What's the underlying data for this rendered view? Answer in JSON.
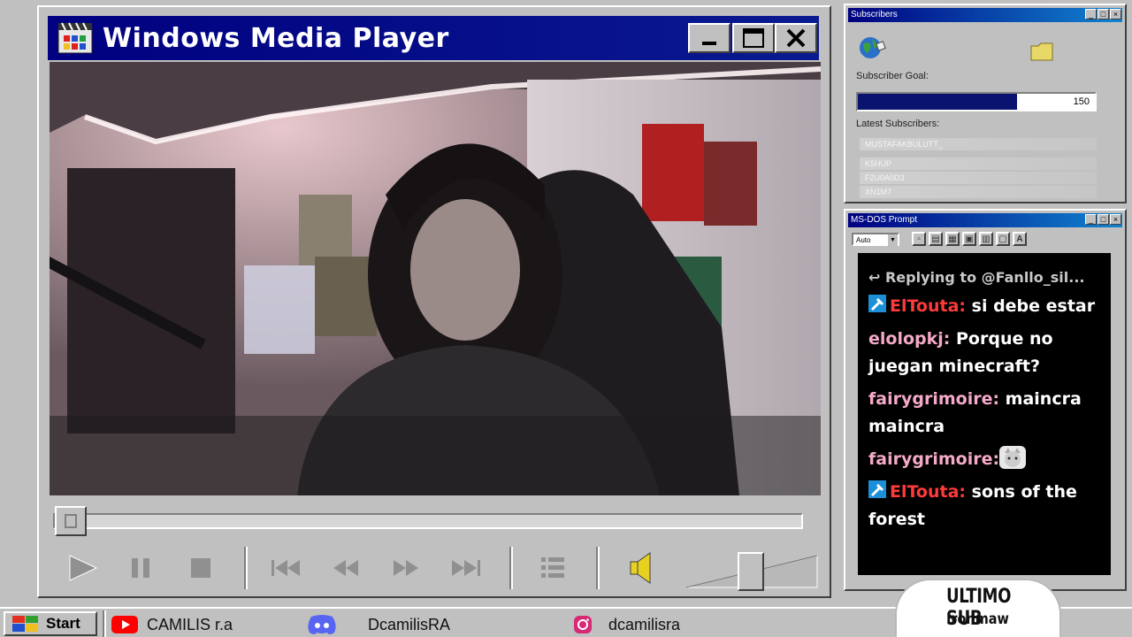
{
  "player": {
    "title": "Windows Media Player",
    "seek_progress": 0.0
  },
  "subscribers": {
    "title": "Subscribers",
    "goal_label": "Subscriber Goal:",
    "goal_value": "150",
    "goal_progress": 0.67,
    "latest_label": "Latest Subscribers:",
    "latest": [
      {
        "name": "MUSTAFAKBULUTT_"
      },
      {
        "name": "K5HUP"
      },
      {
        "name": "F2U0A0D3"
      },
      {
        "name": "XN1M7"
      }
    ]
  },
  "dos": {
    "title": "MS-DOS Prompt",
    "font_select": "Auto",
    "font_tool_label": "A"
  },
  "chat": {
    "reply_line": "Replying to @Fanllo_sil...",
    "messages": [
      {
        "user": "ElTouta:",
        "text": " si debe estar",
        "color": "#ff3a3a",
        "badge": true
      },
      {
        "user": "elolopkj:",
        "text": " Porque no juegan minecraft?",
        "color": "#f4a9c8",
        "badge": false
      },
      {
        "user": "fairygrimoire:",
        "text": " maincra maincra",
        "color": "#f4a9c8",
        "badge": false
      },
      {
        "user": "fairygrimoire:",
        "text": "",
        "color": "#f4a9c8",
        "badge": false,
        "emote": true
      },
      {
        "user": "ElTouta:",
        "text": " sons of the forest",
        "color": "#ff3a3a",
        "badge": true
      }
    ]
  },
  "taskbar": {
    "start_label": "Start",
    "youtube_label": "CAMILIS r.a",
    "discord_label": "DcamilisRA",
    "instagram_label": "dcamilisra"
  },
  "ultimo_sub": {
    "title": "ULTIMO SUB",
    "name": "Ironmaw"
  },
  "colors": {
    "titlebar": "#000080",
    "window_face": "#c0c0c0",
    "chat_bg": "#000000",
    "youtube_red": "#ff0000",
    "discord_blurple": "#5865f2"
  }
}
